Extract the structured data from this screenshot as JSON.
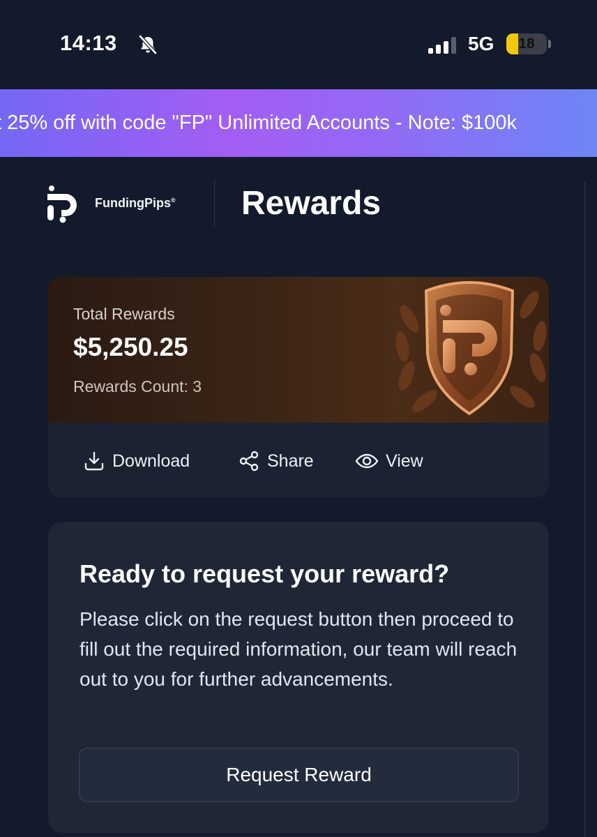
{
  "status_bar": {
    "time": "14:13",
    "network": "5G",
    "battery_level": "18",
    "battery_fraction": 0.18,
    "battery_color": "#f0c80e",
    "icons": [
      "bell-slash-icon",
      "signal-bars-icon",
      "battery-icon"
    ]
  },
  "promo_banner": {
    "text": "t 25% off with code \"FP\" Unlimited Accounts - Note: $100k"
  },
  "header": {
    "brand_name": "FundingPips",
    "brand_mark": "®",
    "title": "Rewards"
  },
  "rewards_card": {
    "total_label": "Total Rewards",
    "total_value": "$5,250.25",
    "count_label": "Rewards Count: 3",
    "actions": [
      {
        "label": "Download",
        "icon": "download-icon"
      },
      {
        "label": "Share",
        "icon": "share-icon"
      },
      {
        "label": "View",
        "icon": "eye-icon"
      }
    ]
  },
  "request_card": {
    "title": "Ready to request your reward?",
    "body": "Please click on the request button then proceed to fill out the required information, our team will reach out to you for further advancements.",
    "button_label": "Request Reward"
  },
  "colors": {
    "background": "#131a2b",
    "card": "#1f2737",
    "banner_gradient": [
      "#7468f4",
      "#a35df3",
      "#6d86f6"
    ],
    "bronze": "#b86a36"
  }
}
